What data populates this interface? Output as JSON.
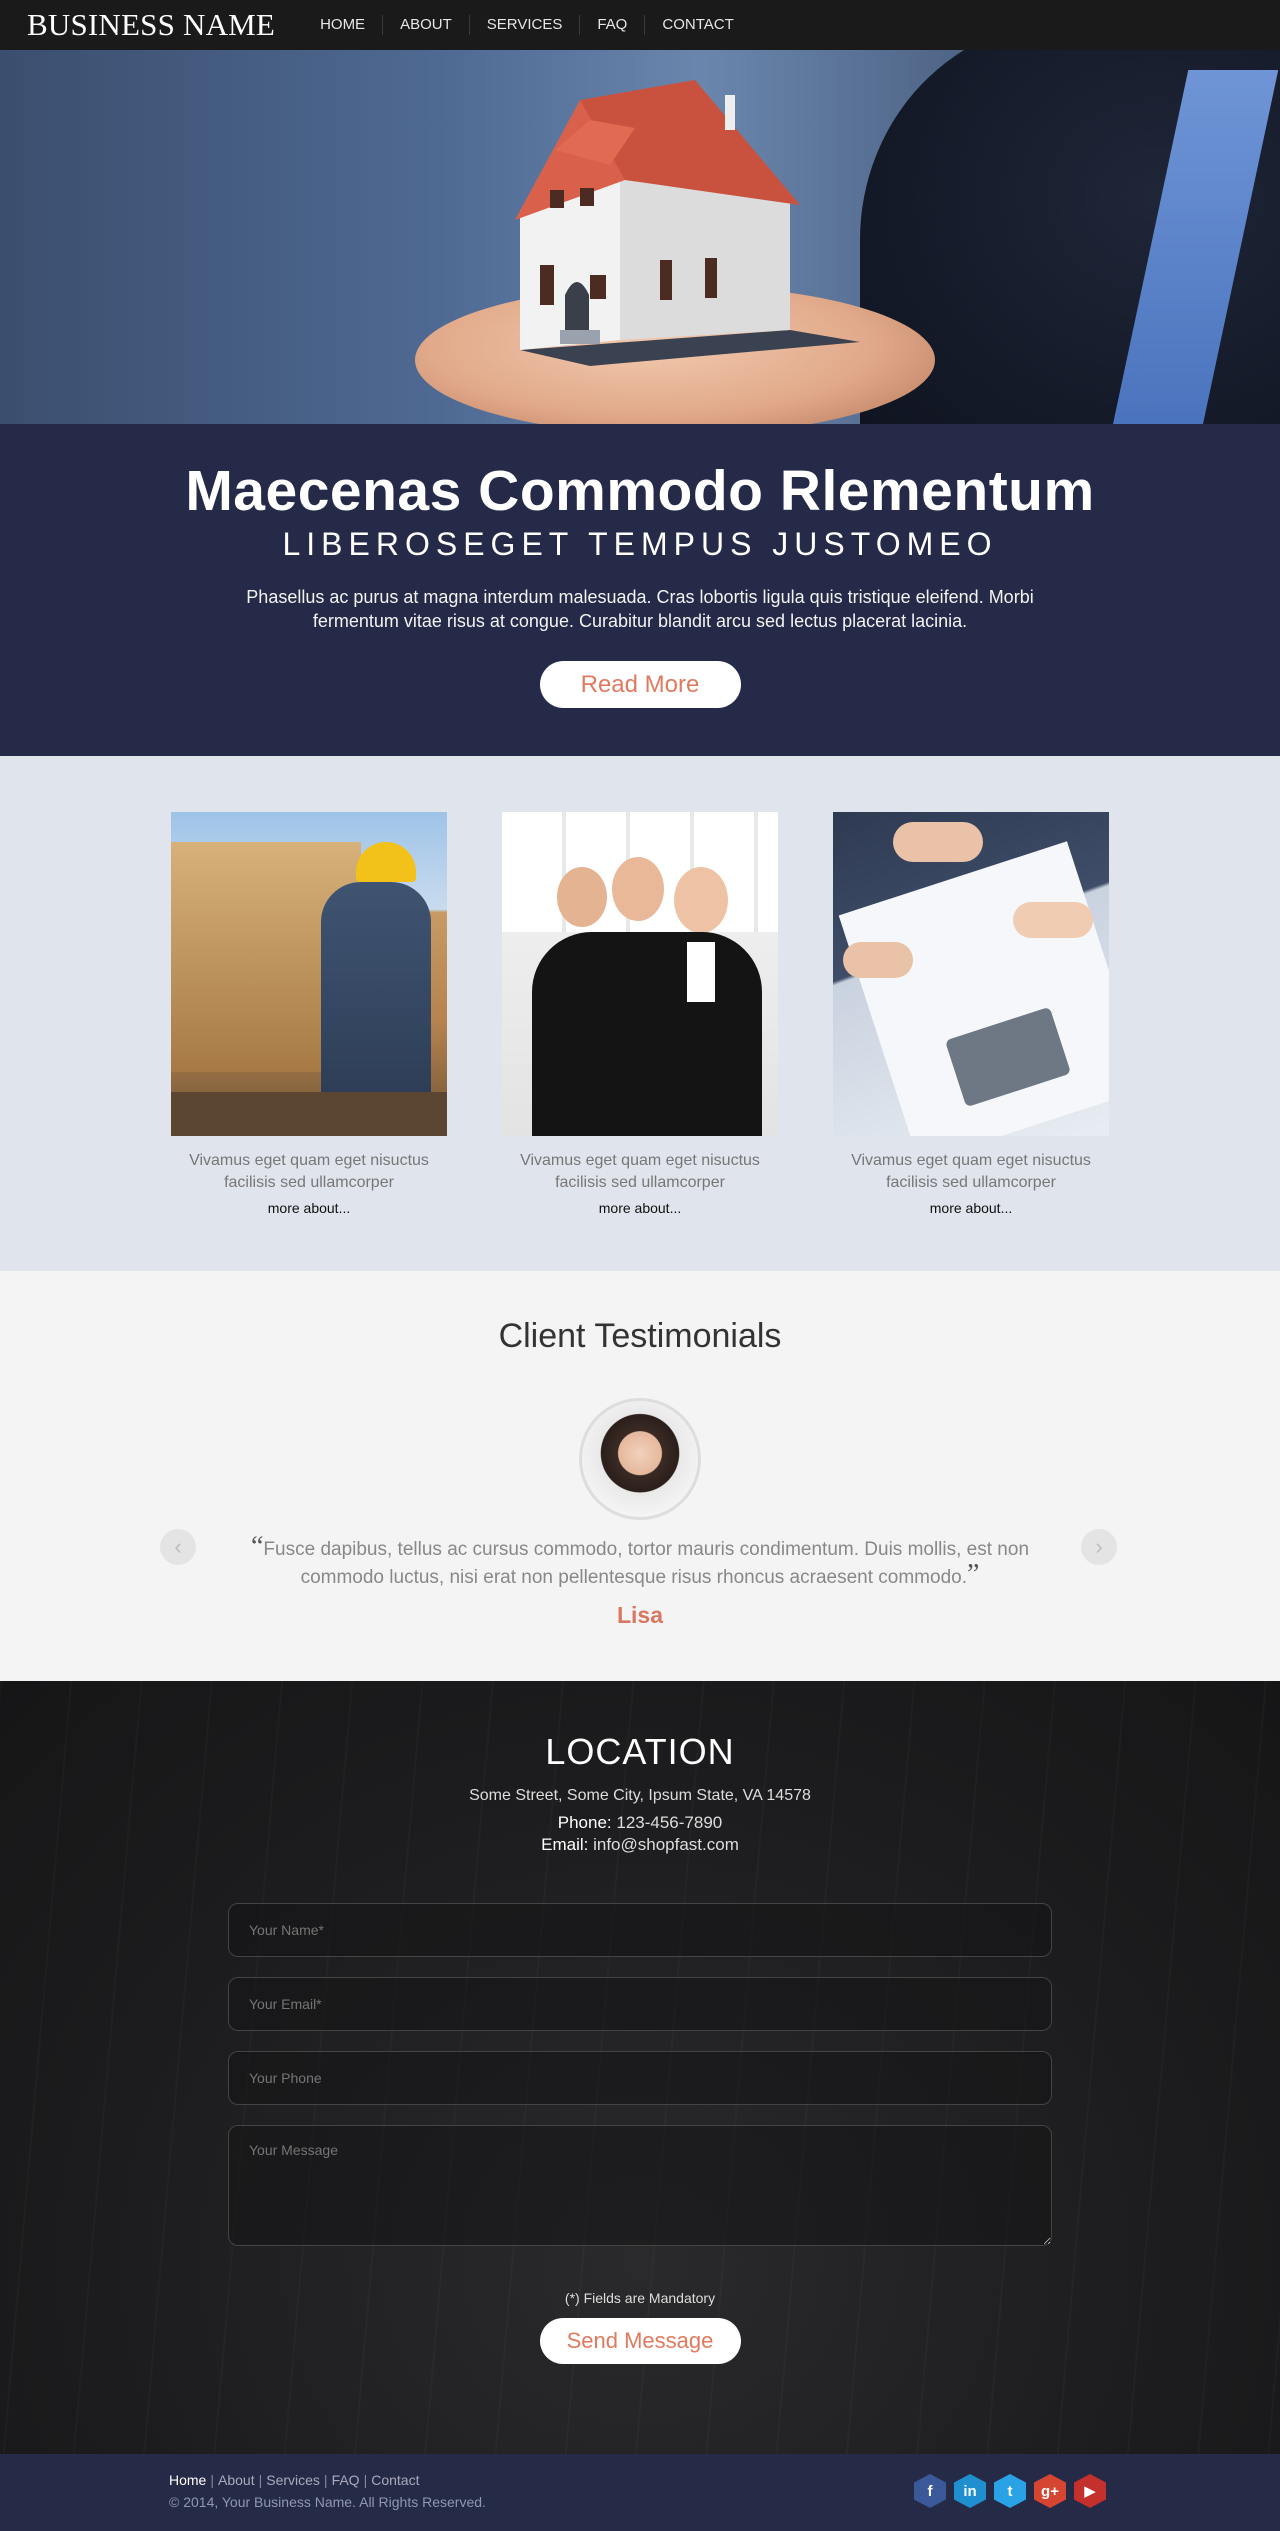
{
  "nav": {
    "brand": "BUSINESS NAME",
    "items": [
      "HOME",
      "ABOUT",
      "SERVICES",
      "FAQ",
      "CONTACT"
    ]
  },
  "hero": {
    "title": "Maecenas Commodo Rlementum",
    "subtitle": "LIBEROSEGET TEMPUS JUSTOMEO",
    "description": "Phasellus ac purus at magna interdum malesuada. Cras lobortis ligula quis tristique eleifend. Morbi fermentum vitae risus at congue. Curabitur blandit arcu sed lectus placerat lacinia.",
    "button": "Read More"
  },
  "features": {
    "cards": [
      {
        "caption": "Vivamus eget quam eget nisuctus facilisis sed ullamcorper",
        "link": "more about..."
      },
      {
        "caption": "Vivamus eget quam eget nisuctus facilisis sed ullamcorper",
        "link": "more about..."
      },
      {
        "caption": "Vivamus eget quam eget nisuctus facilisis sed ullamcorper",
        "link": "more about..."
      }
    ]
  },
  "testimonials": {
    "title": "Client Testimonials",
    "open_quote": "“",
    "close_quote": "”",
    "quote": "Fusce dapibus, tellus ac cursus commodo, tortor mauris condimentum. Duis mollis, est non commodo luctus, nisi erat non pellentesque risus rhoncus acraesent commodo.",
    "name": "Lisa",
    "prev": "‹",
    "next": "›"
  },
  "location": {
    "title": "LOCATION",
    "address": "Some Street, Some City, Ipsum State, VA 14578",
    "phone_label": "Phone:",
    "phone": "123-456-7890",
    "email_label": "Email:",
    "email": "info@shopfast.com",
    "form": {
      "name_placeholder": "Your Name*",
      "email_placeholder": "Your Email*",
      "phone_placeholder": "Your Phone",
      "message_placeholder": "Your Message"
    },
    "mandatory": "(*) Fields are Mandatory",
    "send": "Send Message"
  },
  "footer": {
    "links": [
      "Home",
      "About",
      "Services",
      "FAQ",
      "Contact"
    ],
    "separator": "|",
    "copyright": "© 2014, Your Business Name. All Rights Reserved.",
    "social": [
      {
        "icon": "facebook-icon",
        "glyph": "f",
        "color": "#3b5998"
      },
      {
        "icon": "linkedin-icon",
        "glyph": "in",
        "color": "#1f8fd0"
      },
      {
        "icon": "twitter-icon",
        "glyph": "t",
        "color": "#2aa3e6"
      },
      {
        "icon": "google-plus-icon",
        "glyph": "g+",
        "color": "#d64432"
      },
      {
        "icon": "youtube-icon",
        "glyph": "▶",
        "color": "#c4302b"
      }
    ]
  },
  "colors": {
    "accent": "#e07a5f",
    "hero_bg": "#242a47",
    "features_bg": "#e0e4ec",
    "footer_bg": "#252a47"
  }
}
